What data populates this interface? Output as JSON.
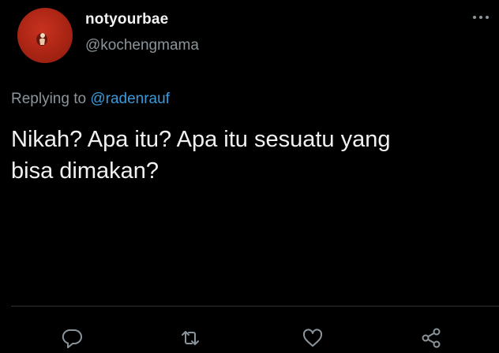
{
  "tweet": {
    "display_name": "notyourbae",
    "handle": "@kochengmama",
    "replying_prefix": "Replying to ",
    "replying_to": "@radenrauf",
    "text": "Nikah? Apa itu? Apa itu sesuatu yang\nbisa dimakan?"
  },
  "icons": {
    "more": "more-horizontal-icon",
    "reply": "reply-icon",
    "retweet": "retweet-icon",
    "like": "heart-icon",
    "share": "share-icon"
  },
  "colors": {
    "background": "#000000",
    "text": "#f1f1f1",
    "secondary_text": "#8b949a",
    "mention": "#3a9ad9",
    "avatar": "#a92414"
  }
}
